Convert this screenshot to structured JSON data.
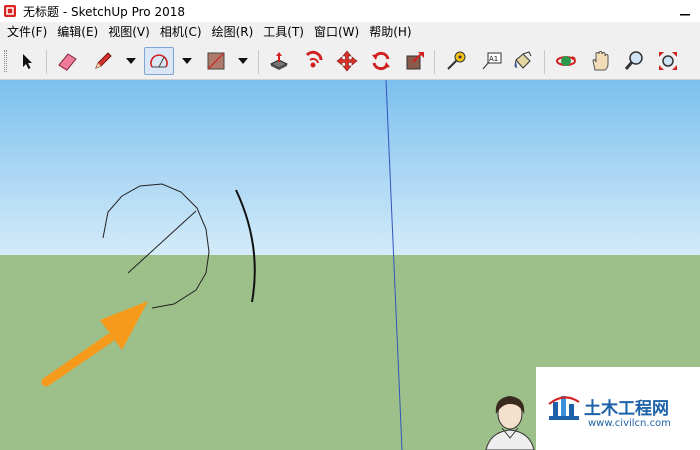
{
  "window": {
    "title": "无标题 - SketchUp Pro 2018"
  },
  "menu": {
    "items": [
      "文件(F)",
      "编辑(E)",
      "视图(V)",
      "相机(C)",
      "绘图(R)",
      "工具(T)",
      "窗口(W)",
      "帮助(H)"
    ]
  },
  "toolbar": {
    "tools": [
      "select-icon",
      "eraser-icon",
      "pencil-icon",
      "arc-icon",
      "rectangle-icon",
      "push-pull-icon",
      "follow-me-icon",
      "move-icon",
      "rotate-icon",
      "offset-icon",
      "tape-measure-icon",
      "text-icon",
      "paint-bucket-icon",
      "orbit-icon",
      "pan-icon",
      "zoom-icon",
      "zoom-extents-icon"
    ],
    "active_tool": "arc-icon",
    "text_tool_label": "A1"
  },
  "colors": {
    "sky_top": "#7cc0ee",
    "sky_bottom": "#d4ebf9",
    "ground": "#9dbf89",
    "arrow": "#f59a1b",
    "axis_blue": "#3355bb"
  },
  "watermark": {
    "name": "土木工程网",
    "url": "www.civilcn.com"
  }
}
